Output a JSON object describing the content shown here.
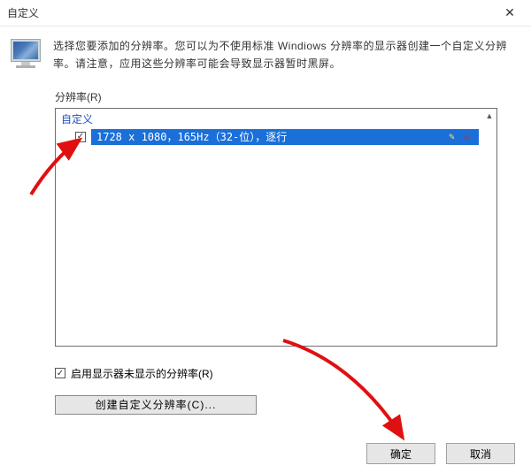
{
  "title": "自定义",
  "description": "选择您要添加的分辨率。您可以为不使用标准 Windiows 分辨率的显示器创建一个自定义分辨率。请注意，应用这些分辨率可能会导致显示器暂时黑屏。",
  "resolution_label": "分辨率(R)",
  "group": "自定义",
  "resolution_item": "1728 x 1080，165Hz（32-位），逐行",
  "enable_nonlisted_label": "启用显示器未显示的分辨率(R)",
  "create_button": "创建自定义分辨率(C)...",
  "ok": "确定",
  "cancel": "取消"
}
